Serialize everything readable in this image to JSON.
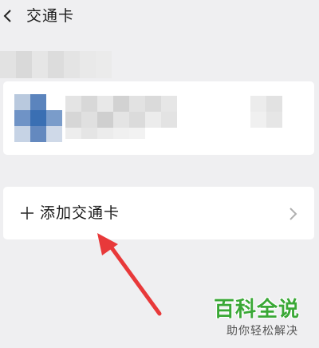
{
  "header": {
    "title": "交通卡",
    "back_icon": "chevron-left-icon"
  },
  "existing_card": {
    "content": "obscured"
  },
  "add_card": {
    "plus_icon": "plus-icon",
    "label": "添加交通卡",
    "chevron_icon": "chevron-right-icon"
  },
  "annotation": {
    "arrow_color": "#e8393a"
  },
  "watermark": {
    "title": "百科全说",
    "subtitle": "助你轻松解决",
    "color": "#3aa836"
  }
}
